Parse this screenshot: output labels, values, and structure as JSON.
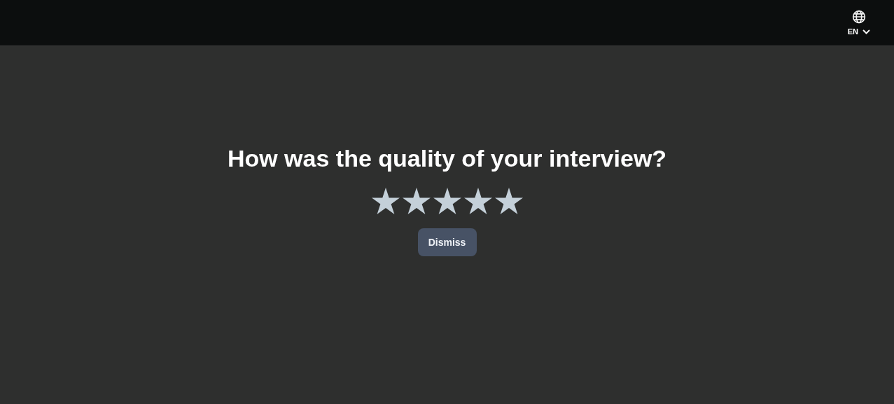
{
  "header": {
    "language": "EN"
  },
  "survey": {
    "question": "How was the quality of your interview?",
    "stars": 5,
    "dismiss": "Dismiss"
  }
}
